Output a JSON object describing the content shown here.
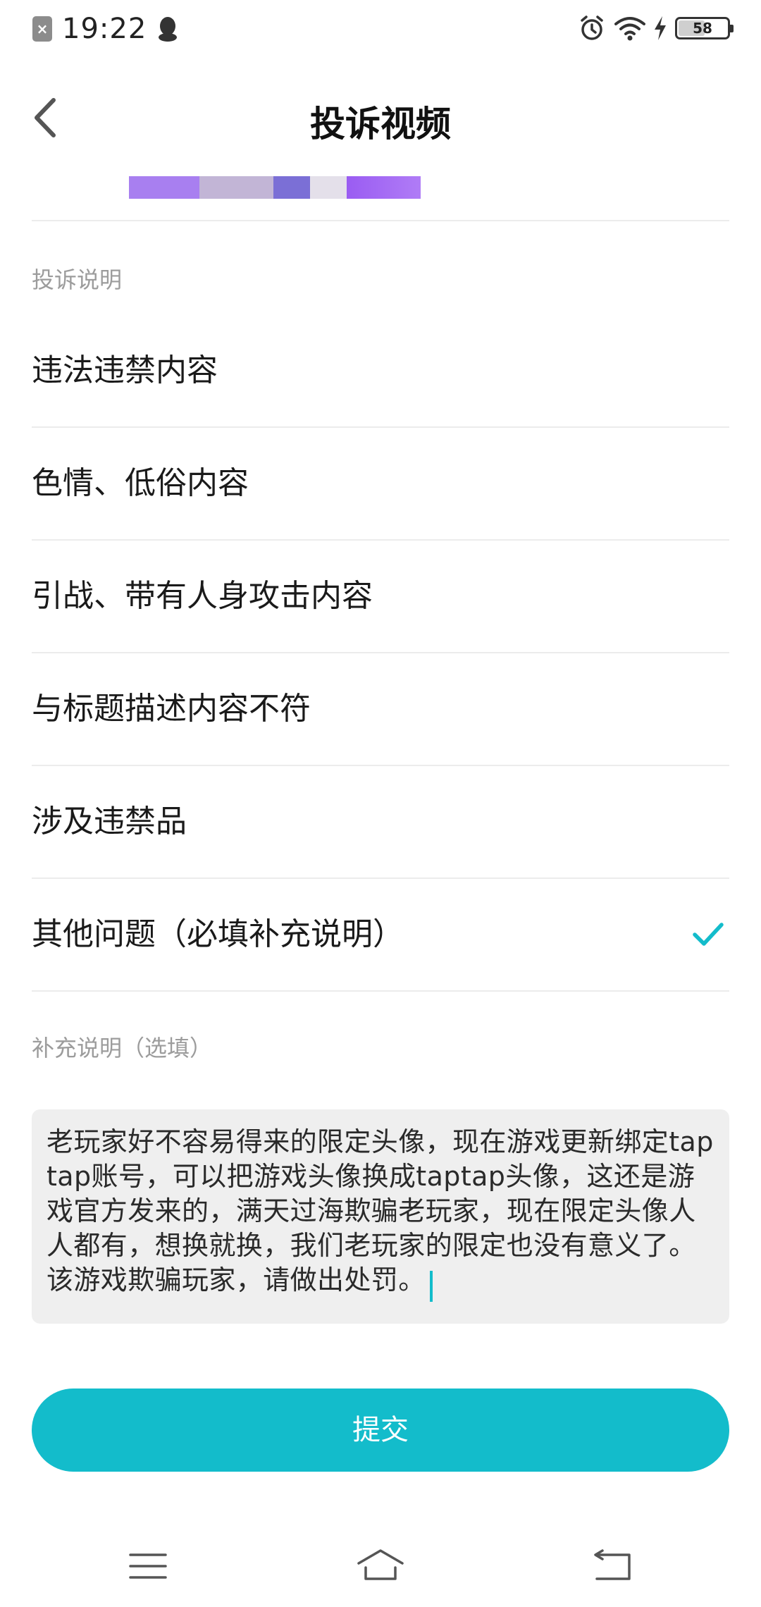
{
  "status_bar": {
    "time": "19:22",
    "battery": "58"
  },
  "header": {
    "title": "投诉视频"
  },
  "complaint": {
    "section_label": "投诉说明",
    "options": [
      {
        "label": "违法违禁内容",
        "selected": false
      },
      {
        "label": "色情、低俗内容",
        "selected": false
      },
      {
        "label": "引战、带有人身攻击内容",
        "selected": false
      },
      {
        "label": "与标题描述内容不符",
        "selected": false
      },
      {
        "label": "涉及违禁品",
        "selected": false
      },
      {
        "label": "其他问题（必填补充说明）",
        "selected": true
      }
    ]
  },
  "supplement": {
    "label": "补充说明（选填）",
    "value": "老玩家好不容易得来的限定头像，现在游戏更新绑定taptap账号，可以把游戏头像换成taptap头像，这还是游戏官方发来的，满天过海欺骗老玩家，现在限定头像人人都有，想换就换，我们老玩家的限定也没有意义了。该游戏欺骗玩家，请做出处罚。"
  },
  "submit": {
    "label": "提交"
  },
  "colors": {
    "accent": "#13bccb",
    "divider": "#ececec",
    "secondary_text": "#9c9c9c",
    "input_background": "#efefef"
  },
  "icons": {
    "back": "chevron-left-icon",
    "selected": "check-icon",
    "nav_menu": "menu-icon",
    "nav_home": "home-icon",
    "nav_back": "back-icon"
  }
}
